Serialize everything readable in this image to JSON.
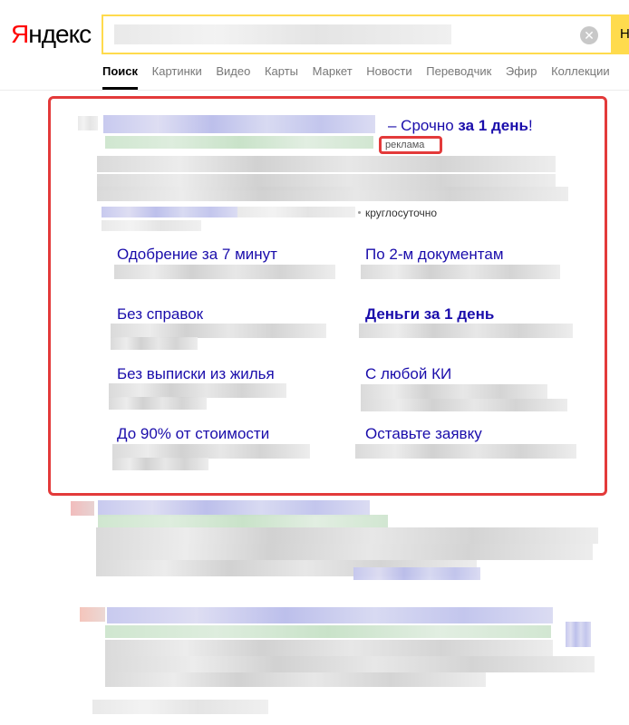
{
  "header": {
    "logo": {
      "first": "Я",
      "rest": "ндекс"
    },
    "search": {
      "clear_glyph": "✕",
      "find_label": "Н"
    },
    "nav": [
      "Поиск",
      "Картинки",
      "Видео",
      "Карты",
      "Маркет",
      "Новости",
      "Переводчик",
      "Эфир",
      "Коллекции"
    ]
  },
  "ad": {
    "title_tail": "– Срочно ",
    "title_bold": "за 1 день",
    "title_end": "!",
    "badge": "реклама",
    "hours": "круглосуточно",
    "sitelinks": [
      {
        "label": "Одобрение за 7 минут",
        "bold": false
      },
      {
        "label": "По 2-м документам",
        "bold": false
      },
      {
        "label": "Без справок",
        "bold": false
      },
      {
        "label": "Деньги за 1 день",
        "bold": true
      },
      {
        "label": "Без выписки из жилья",
        "bold": false
      },
      {
        "label": "С любой КИ",
        "bold": false
      },
      {
        "label": "До 90% от стоимости",
        "bold": false
      },
      {
        "label": "Оставьте заявку",
        "bold": false
      }
    ]
  },
  "colors": {
    "accent": "#ffdb4d",
    "link": "#1a0dab",
    "highlight": "#e33a3a",
    "logo_red": "#ff0000"
  }
}
